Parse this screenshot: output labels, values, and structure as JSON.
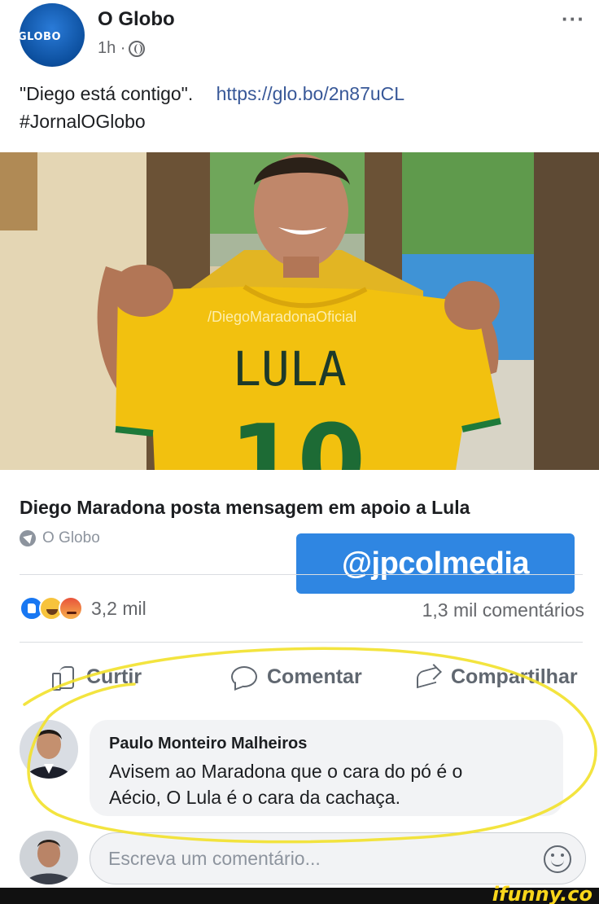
{
  "post": {
    "page_name": "O Globo",
    "avatar_text": "GLOBO",
    "time": "1h ·",
    "more_label": "···",
    "text_quote": "\"Diego está contigo\".",
    "text_link": "https://glo.bo/2n87uCL",
    "hashtag": "#JornalOGlobo"
  },
  "photo": {
    "shirt_text": "LULA",
    "shirt_number": "10",
    "photo_watermark": "/DiegoMaradonaOficial"
  },
  "article": {
    "title": "Diego Maradona posta mensagem em apoio a Lula",
    "source": "O Globo"
  },
  "watermark": "@jpcolmedia",
  "stats": {
    "reactions_count": "3,2 mil",
    "comments_count": "1,3 mil comentários"
  },
  "actions": {
    "like": "Curtir",
    "comment": "Comentar",
    "share": "Compartilhar"
  },
  "comment": {
    "author": "Paulo Monteiro Malheiros",
    "line1": "Avisem ao Maradona que o cara do pó é o",
    "line2": "Aécio, O Lula é o cara da cachaça."
  },
  "composer": {
    "placeholder": "Escreva um comentário..."
  },
  "footer": {
    "brand": "ifunny.co"
  },
  "colors": {
    "facebook_blue": "#1877f2",
    "link_blue": "#385898",
    "watermark_blue": "#2f86e2",
    "highlight_yellow": "#f2e12a",
    "shirt_yellow": "#f2c10f"
  }
}
